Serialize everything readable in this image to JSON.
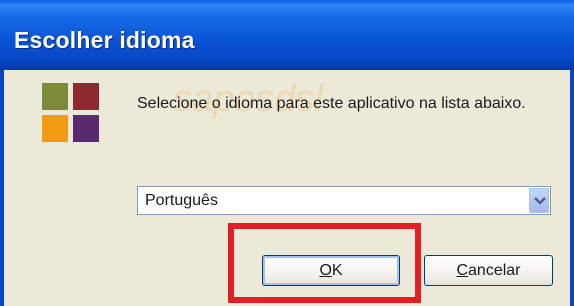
{
  "window": {
    "title": "Escolher idioma"
  },
  "dialog": {
    "prompt": "Selecione o idioma para este aplicativo na lista abaixo.",
    "watermark": "saposdsl"
  },
  "language_select": {
    "selected_value": "Português"
  },
  "buttons": {
    "ok": {
      "accel": "O",
      "rest": "K"
    },
    "cancel": {
      "accel": "C",
      "rest": "ancelar"
    }
  },
  "colors": {
    "title_bar": "#0a55d8",
    "dialog_background": "#ece9d8",
    "highlight_box": "#e31e24",
    "icon_squares": [
      "#7c8a3a",
      "#8e2a2e",
      "#f29a12",
      "#5a2a6e"
    ]
  },
  "icons": {
    "app_icon": "four-color-squares-icon",
    "dropdown": "chevron-down-icon"
  }
}
